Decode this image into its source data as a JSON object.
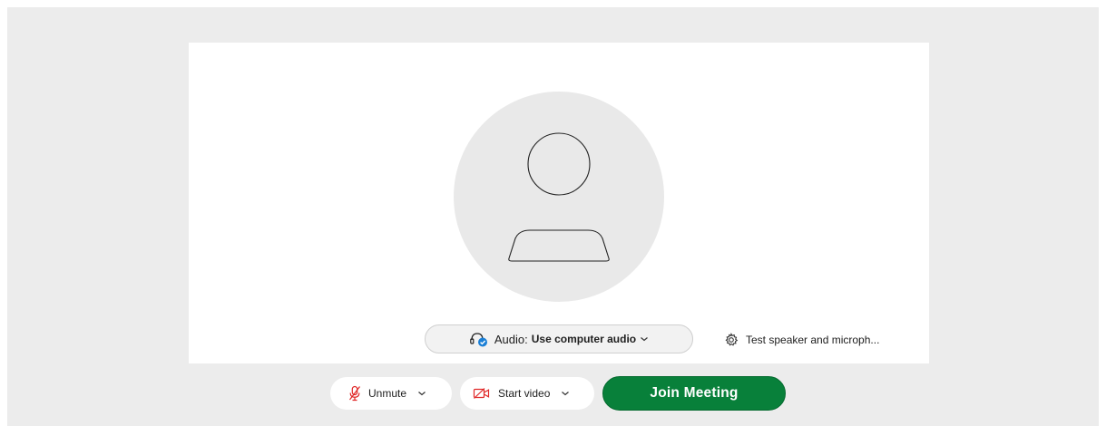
{
  "preview": {
    "avatar_icon": "person-silhouette-icon"
  },
  "audio": {
    "prefix": "Audio:",
    "selection": "Use computer audio",
    "icon": "headset-check-icon",
    "accent": "#1a7fd6"
  },
  "test_link": {
    "label": "Test speaker and microph...",
    "icon": "gear-icon"
  },
  "controls": {
    "unmute_label": "Unmute",
    "unmute_icon": "mic-muted-icon",
    "video_label": "Start video",
    "video_icon": "video-off-icon",
    "join_label": "Join Meeting"
  },
  "colors": {
    "join_bg": "#08803a",
    "muted_red": "#e02828",
    "stage_bg": "#ececec"
  }
}
